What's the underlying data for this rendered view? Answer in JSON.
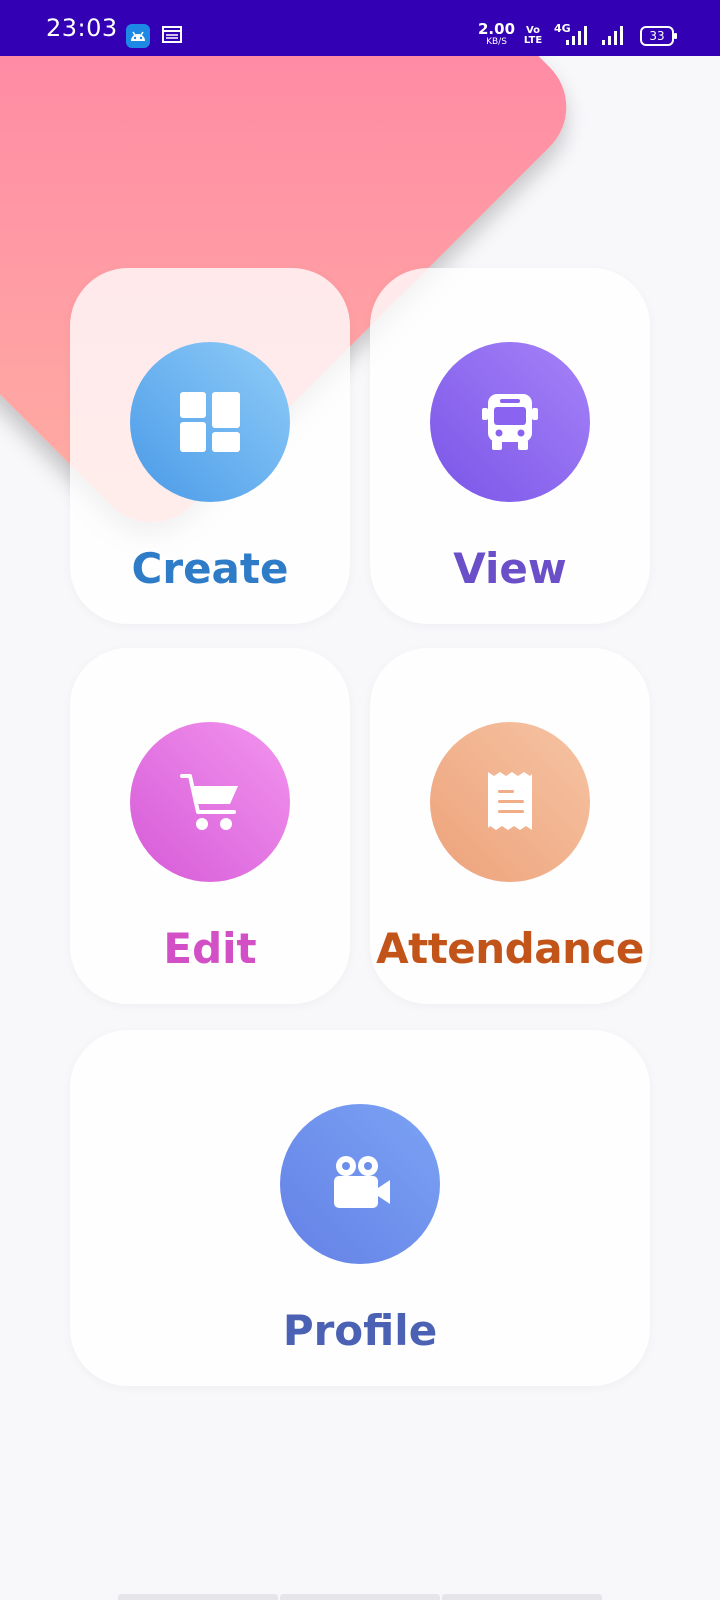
{
  "status_bar": {
    "time": "23:03",
    "net_speed_value": "2.00",
    "net_speed_unit": "KB/S",
    "volte_line1": "Vo",
    "volte_line2": "LTE",
    "network_type": "4G",
    "battery": "33"
  },
  "menu": {
    "create": {
      "label": "Create",
      "icon": "dashboard-icon",
      "color": "#2e7bc7"
    },
    "view": {
      "label": "View",
      "icon": "bus-icon",
      "color": "#6a4fc8"
    },
    "edit": {
      "label": "Edit",
      "icon": "cart-icon",
      "color": "#d24fc6"
    },
    "attendance": {
      "label": "Attendance",
      "icon": "receipt-icon",
      "color": "#c2541a"
    },
    "profile": {
      "label": "Profile",
      "icon": "video-camera-icon",
      "color": "#4b62b4"
    }
  }
}
